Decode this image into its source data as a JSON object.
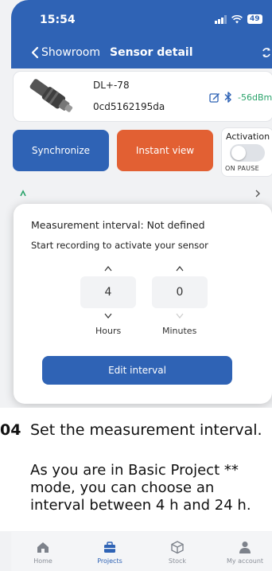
{
  "status_bar": {
    "time": "15:54",
    "battery": "49"
  },
  "nav": {
    "back_label": "Showroom",
    "title": "Sensor detail"
  },
  "sensor": {
    "name": "DL+-78",
    "id": "0cd5162195da",
    "rssi": "-56dBm"
  },
  "actions": {
    "synchronize_label": "Synchronize",
    "instant_view_label": "Instant view",
    "activation_label": "Activation",
    "activation_state": "ON PAUSE"
  },
  "modal": {
    "title": "Measurement interval: Not defined",
    "subtitle": "Start recording to activate your sensor",
    "hours_value": "4",
    "minutes_value": "0",
    "hours_label": "Hours",
    "minutes_label": "Minutes",
    "edit_button_label": "Edit interval"
  },
  "instruction": {
    "step_number": "04",
    "heading": "Set the measurement interval.",
    "body_lines": [
      "As you are in Basic Project **",
      "mode, you can choose an",
      "interval between 4 h and 24 h."
    ]
  },
  "tabbar": {
    "items": [
      {
        "label": "Home",
        "icon": "home-icon"
      },
      {
        "label": "Projects",
        "icon": "briefcase-icon"
      },
      {
        "label": "Stock",
        "icon": "box-icon"
      },
      {
        "label": "My account",
        "icon": "person-icon"
      }
    ],
    "active_index": 1
  },
  "colors": {
    "primary": "#2f63b5",
    "accent_orange": "#e26033",
    "signal_green": "#2aa36b"
  }
}
